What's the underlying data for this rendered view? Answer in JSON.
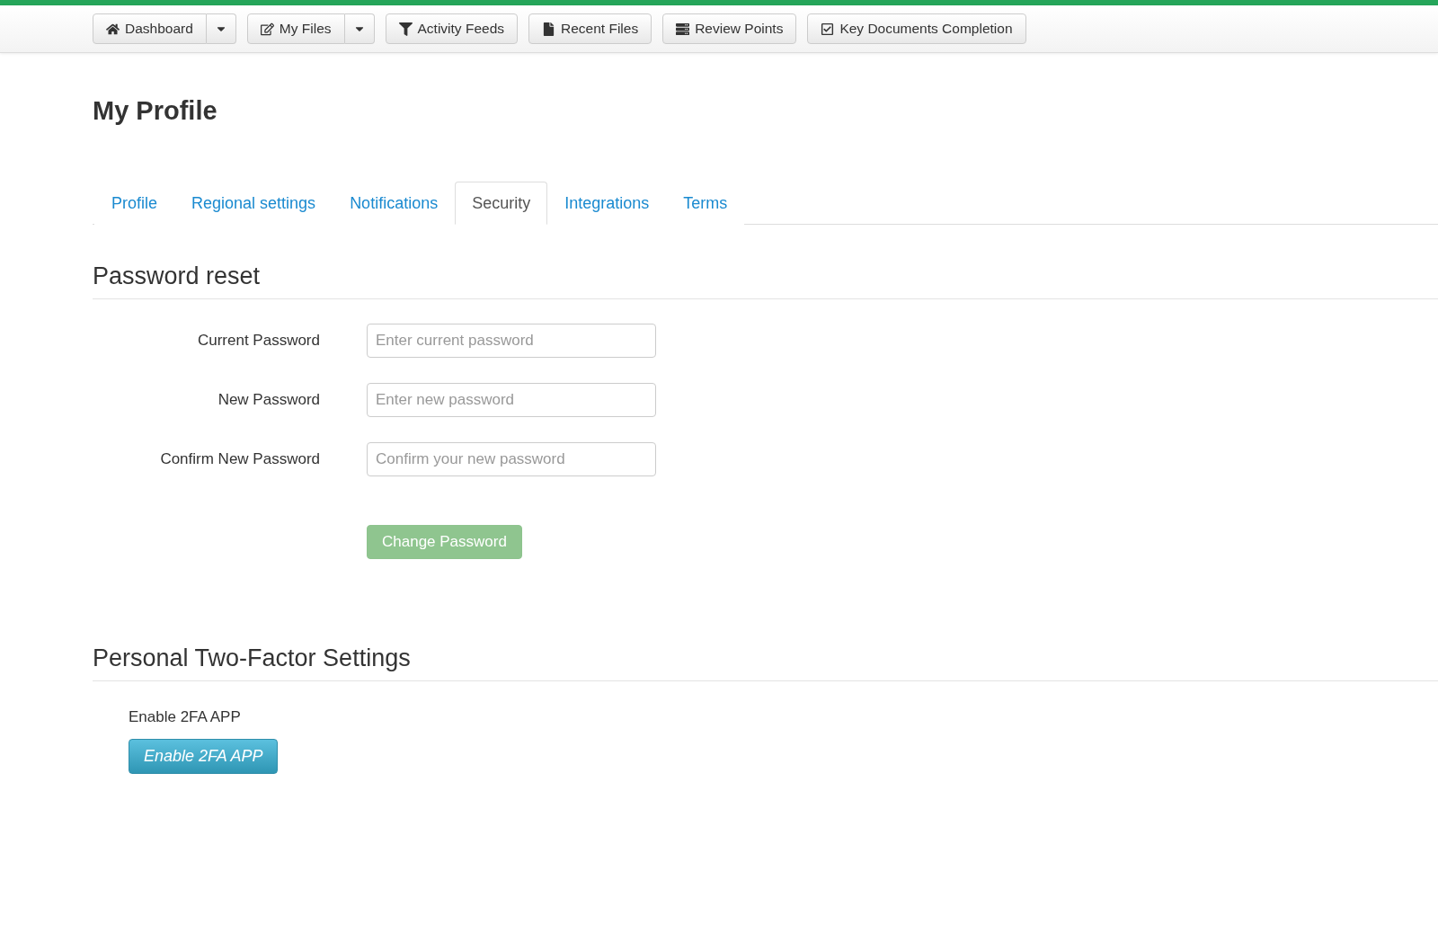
{
  "toolbar": [
    {
      "label": "Dashboard",
      "kind": "home",
      "dropdown": true
    },
    {
      "label": "My Files",
      "kind": "edit",
      "dropdown": true
    },
    {
      "label": "Activity Feeds",
      "kind": "filter",
      "dropdown": false
    },
    {
      "label": "Recent Files",
      "kind": "file",
      "dropdown": false
    },
    {
      "label": "Review Points",
      "kind": "list",
      "dropdown": false
    },
    {
      "label": "Key Documents Completion",
      "kind": "check",
      "dropdown": false
    }
  ],
  "page_title": "My Profile",
  "tabs": [
    {
      "label": "Profile",
      "selected": false
    },
    {
      "label": "Regional settings",
      "selected": false
    },
    {
      "label": "Notifications",
      "selected": false
    },
    {
      "label": "Security",
      "selected": true
    },
    {
      "label": "Integrations",
      "selected": false
    },
    {
      "label": "Terms",
      "selected": false
    }
  ],
  "password_reset": {
    "heading": "Password reset",
    "fields": [
      {
        "label": "Current Password",
        "placeholder": "Enter current password"
      },
      {
        "label": "New Password",
        "placeholder": "Enter new password"
      },
      {
        "label": "Confirm New Password",
        "placeholder": "Confirm your new password"
      }
    ],
    "button": {
      "label": "Change Password",
      "disabled": true
    }
  },
  "two_factor": {
    "heading": "Personal Two-Factor Settings",
    "label": "Enable 2FA APP",
    "button": "Enable 2FA APP"
  }
}
